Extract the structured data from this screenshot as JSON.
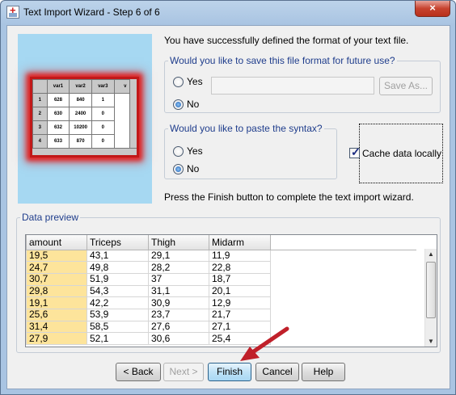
{
  "window": {
    "title": "Text Import Wizard - Step 6 of 6",
    "close_label": "×"
  },
  "graphic": {
    "columns": [
      "var1",
      "var2",
      "var3",
      "v"
    ],
    "rows": [
      [
        "1",
        "628",
        "840",
        "1"
      ],
      [
        "2",
        "630",
        "2400",
        "0"
      ],
      [
        "3",
        "632",
        "10200",
        "0"
      ],
      [
        "4",
        "633",
        "870",
        "0"
      ]
    ]
  },
  "success_message": "You have successfully defined the format of your text file.",
  "save_format": {
    "legend": "Would you like to save this file format for future use?",
    "yes_label": "Yes",
    "no_label": "No",
    "selected": "No",
    "path_value": "",
    "save_as_label": "Save As..."
  },
  "paste_syntax": {
    "legend": "Would you like to paste the syntax?",
    "yes_label": "Yes",
    "no_label": "No",
    "selected": "No"
  },
  "cache": {
    "label": "Cache data locally",
    "checked": true
  },
  "finish_message": "Press the Finish button to complete the text import wizard.",
  "preview": {
    "legend": "Data preview",
    "columns": [
      "amount",
      "Triceps",
      "Thigh",
      "Midarm"
    ],
    "rows": [
      [
        "19,5",
        "43,1",
        "29,1",
        "11,9"
      ],
      [
        "24,7",
        "49,8",
        "28,2",
        "22,8"
      ],
      [
        "30,7",
        "51,9",
        "37",
        "18,7"
      ],
      [
        "29,8",
        "54,3",
        "31,1",
        "20,1"
      ],
      [
        "19,1",
        "42,2",
        "30,9",
        "12,9"
      ],
      [
        "25,6",
        "53,9",
        "23,7",
        "21,7"
      ],
      [
        "31,4",
        "58,5",
        "27,6",
        "27,1"
      ],
      [
        "27,9",
        "52,1",
        "30,6",
        "25,4"
      ]
    ]
  },
  "buttons": {
    "back": "< Back",
    "next": "Next >",
    "finish": "Finish",
    "cancel": "Cancel",
    "help": "Help"
  },
  "colors": {
    "highlight_column": "#fde49b",
    "annotation_arrow": "#c0202a"
  }
}
